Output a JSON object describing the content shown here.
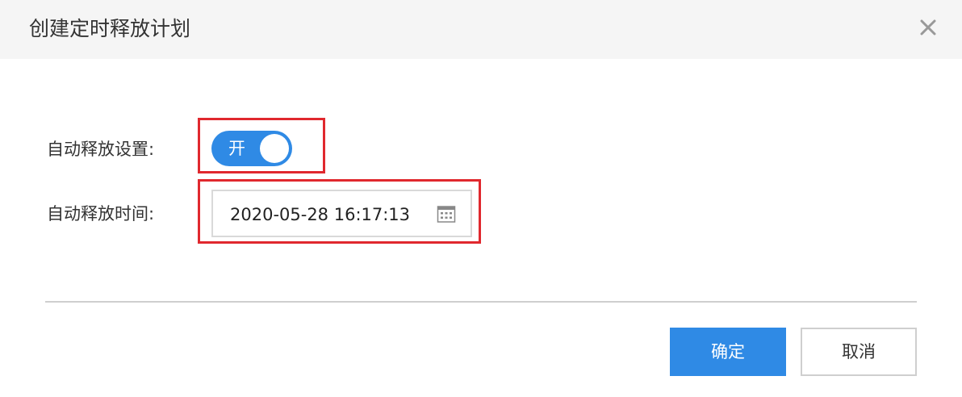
{
  "dialog": {
    "title": "创建定时释放计划",
    "close_icon": "close-icon"
  },
  "form": {
    "auto_release_setting": {
      "label": "自动释放设置:",
      "toggle_text": "开",
      "enabled": true,
      "accent_color": "#2f8ae5"
    },
    "auto_release_time": {
      "label": "自动释放时间:",
      "value": "2020-05-28 16:17:13",
      "icon": "calendar-icon"
    }
  },
  "footer": {
    "confirm_label": "确定",
    "cancel_label": "取消"
  },
  "colors": {
    "header_bg": "#f5f5f5",
    "primary": "#2f8ae5",
    "highlight": "#e0282e",
    "border": "#d9d9d9"
  }
}
